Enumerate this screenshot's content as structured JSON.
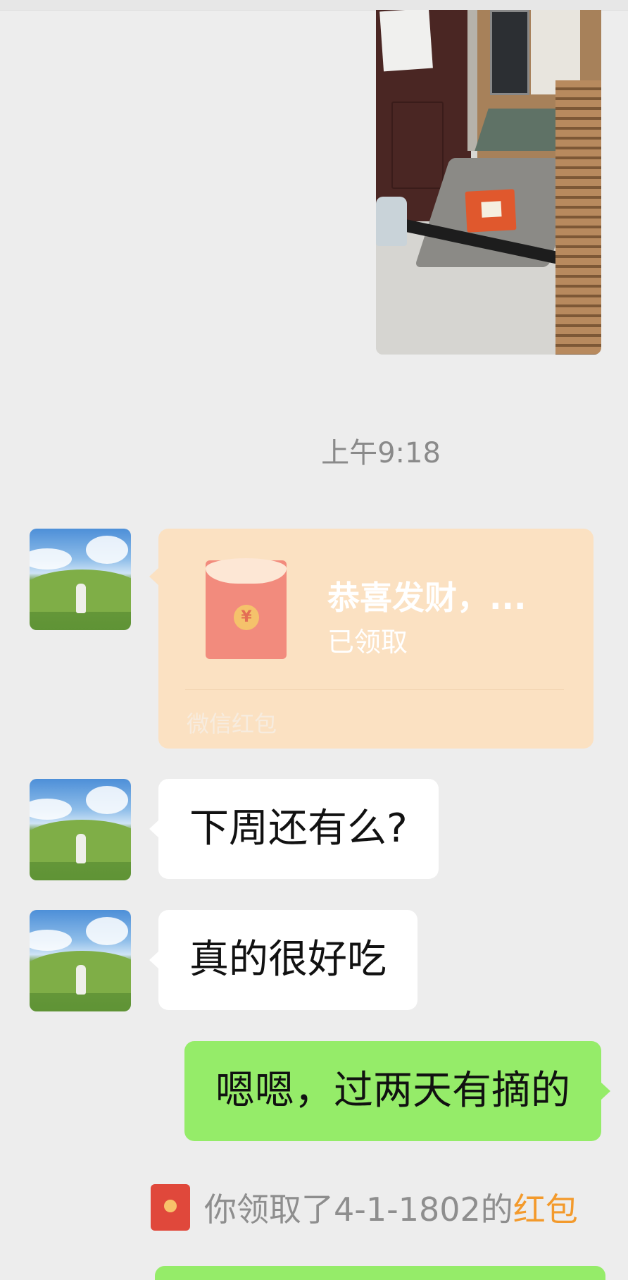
{
  "time_separator": "上午9:18",
  "red_packet": {
    "title": "恭喜发财，...",
    "status": "已领取",
    "brand": "微信红包",
    "coin_symbol": "¥",
    "card_color": "#fbe1c2"
  },
  "messages": [
    {
      "side": "left",
      "text": "下周还有么?"
    },
    {
      "side": "left",
      "text": "真的很好吃"
    },
    {
      "side": "right",
      "text": "嗯嗯，过两天有摘的"
    }
  ],
  "notice": {
    "text": "你领取了4-1-1802的",
    "link": "红包",
    "link_color": "#f39a2c"
  },
  "colors": {
    "background": "#ededed",
    "own_bubble": "#95ec69",
    "other_bubble": "#ffffff"
  }
}
